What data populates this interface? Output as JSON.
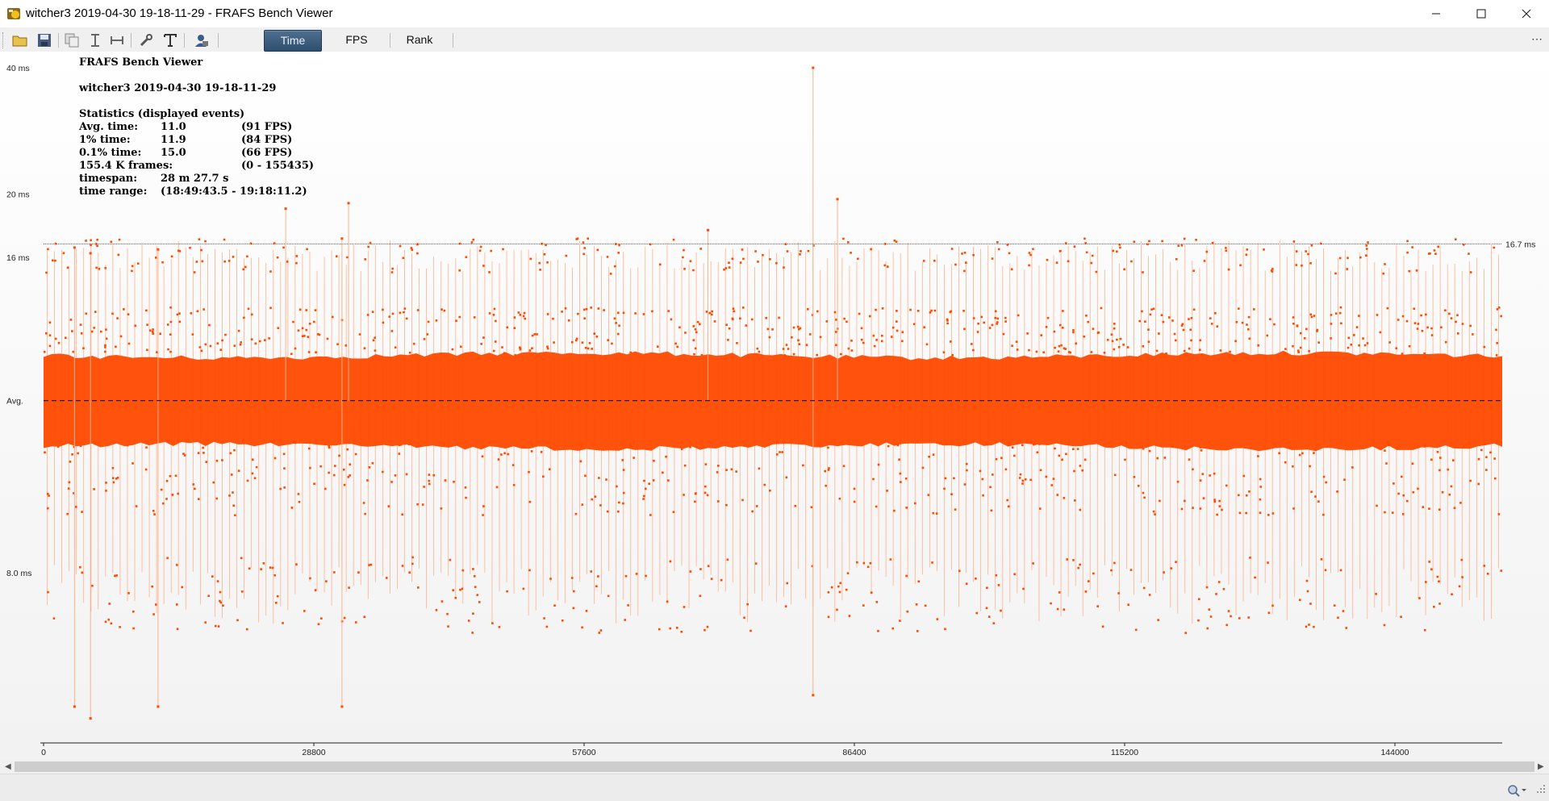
{
  "window": {
    "title": "witcher3 2019-04-30 19-18-11-29 - FRAFS Bench Viewer",
    "controls": [
      "minimize",
      "maximize",
      "close"
    ]
  },
  "toolbar": {
    "icons": [
      "open-folder-icon",
      "save-icon",
      "copy-icon",
      "fit-height-icon",
      "fit-width-icon",
      "settings-wrench-icon",
      "text-icon",
      "user-lock-icon"
    ],
    "tabs": [
      {
        "label": "Time",
        "active": true
      },
      {
        "label": "FPS",
        "active": false
      },
      {
        "label": "Rank",
        "active": false
      }
    ],
    "more": "⋯"
  },
  "stats": {
    "app_name": "FRAFS Bench Viewer",
    "session": "witcher3 2019-04-30 19-18-11-29",
    "heading": "Statistics (displayed events)",
    "rows": [
      {
        "label": "Avg. time:",
        "value": "11.0",
        "extra": "(91 FPS)"
      },
      {
        "label": "1% time:",
        "value": "11.9",
        "extra": "(84 FPS)"
      },
      {
        "label": "0.1% time:",
        "value": "15.0",
        "extra": "(66 FPS)"
      },
      {
        "label": "155.4 K frames:",
        "value": "",
        "extra": "(0 - 155435)"
      },
      {
        "label": "timespan:",
        "value": "28 m 27.7 s",
        "extra": ""
      },
      {
        "label": "time range:",
        "value": "(18:49:43.5 - 19:18:11.2)",
        "extra": ""
      }
    ]
  },
  "colors": {
    "series": "#ff4a00",
    "series_line": "#ffb08a",
    "accent_tab": "#2e4f70"
  },
  "chart_data": {
    "type": "scatter",
    "y_scale": "reciprocal",
    "ytick_labels": [
      "40 ms",
      "20 ms",
      "16 ms",
      "Avg.",
      "8.0 ms"
    ],
    "ytick_values": [
      40,
      20,
      16,
      11.0,
      8.0
    ],
    "xtick_labels": [
      "0",
      "28800",
      "57600",
      "86400",
      "115200",
      "144000"
    ],
    "xtick_values": [
      0,
      28800,
      57600,
      86400,
      115200,
      144000
    ],
    "xlim": [
      0,
      155435
    ],
    "reference_line": {
      "value": 16.7,
      "label": "16.7 ms"
    },
    "average": 11.0,
    "band": {
      "low": 10.0,
      "high": 12.2
    },
    "spikes": [
      {
        "x": 3300,
        "y": 16.5
      },
      {
        "x": 5000,
        "y": 16.2
      },
      {
        "x": 12200,
        "y": 16.4
      },
      {
        "x": 25800,
        "y": 18.9
      },
      {
        "x": 31800,
        "y": 17.0
      },
      {
        "x": 32500,
        "y": 19.3
      },
      {
        "x": 70800,
        "y": 17.5
      },
      {
        "x": 82000,
        "y": 40.0
      },
      {
        "x": 84600,
        "y": 19.6
      }
    ],
    "dips": [
      {
        "x": 3300,
        "y": 6.6
      },
      {
        "x": 5000,
        "y": 6.5
      },
      {
        "x": 12200,
        "y": 6.6
      },
      {
        "x": 31800,
        "y": 6.6
      },
      {
        "x": 82000,
        "y": 6.7
      }
    ],
    "grid": false
  }
}
